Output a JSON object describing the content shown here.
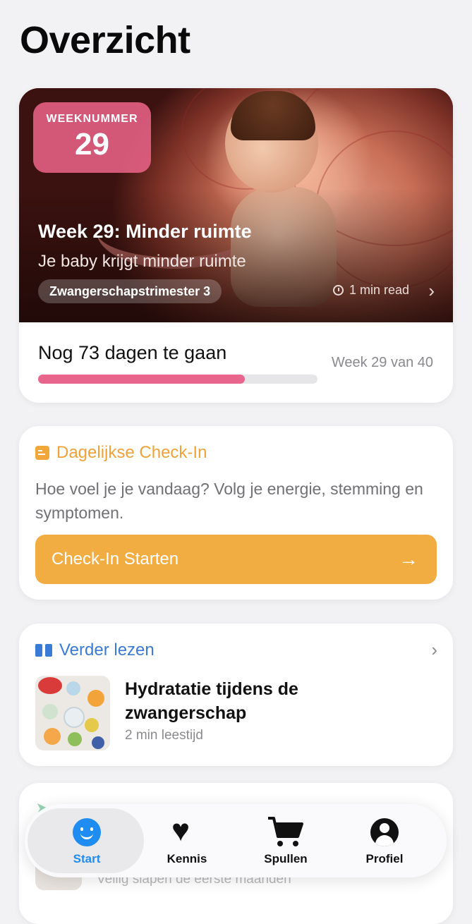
{
  "page": {
    "title": "Overzicht"
  },
  "hero": {
    "week_label": "WEEKNUMMER",
    "week_number": "29",
    "title": "Week 29: Minder ruimte",
    "subtitle": "Je baby krijgt minder ruimte",
    "trimester": "Zwangerschapstrimester 3",
    "read_time": "1 min read"
  },
  "progress": {
    "countdown": "Nog 73 dagen te gaan",
    "week_of": "Week 29 van 40",
    "fraction": 0.74,
    "color": "#e8658e"
  },
  "checkin": {
    "title": "Dagelijkse Check-In",
    "text": "Hoe voel je je vandaag? Volg je energie, stemming en symptomen.",
    "button": "Check-In Starten",
    "accent": "#f2ad42"
  },
  "reading": {
    "title": "Verder lezen",
    "article_title": "Hydratatie tijdens de zwangerschap",
    "article_meta": "2 min leestijd",
    "accent": "#3a7bd5"
  },
  "next_card": {
    "subtitle": "Veilig slapen de eerste maanden"
  },
  "tabbar": {
    "tabs": [
      {
        "label": "Start",
        "icon": "smile-icon",
        "active": true
      },
      {
        "label": "Kennis",
        "icon": "heart-icon"
      },
      {
        "label": "Spullen",
        "icon": "cart-icon"
      },
      {
        "label": "Profiel",
        "icon": "profile-icon"
      }
    ],
    "active_color": "#1e8cf0"
  }
}
